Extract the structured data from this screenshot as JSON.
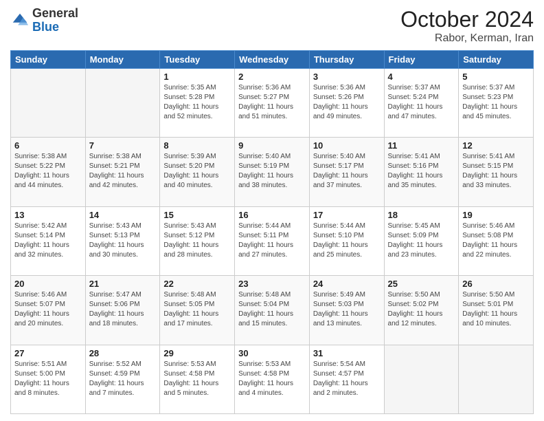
{
  "header": {
    "logo": {
      "line1": "General",
      "line2": "Blue"
    },
    "month": "October 2024",
    "location": "Rabor, Kerman, Iran"
  },
  "weekdays": [
    "Sunday",
    "Monday",
    "Tuesday",
    "Wednesday",
    "Thursday",
    "Friday",
    "Saturday"
  ],
  "weeks": [
    [
      {
        "day": "",
        "sunrise": "",
        "sunset": "",
        "daylight": ""
      },
      {
        "day": "",
        "sunrise": "",
        "sunset": "",
        "daylight": ""
      },
      {
        "day": "1",
        "sunrise": "Sunrise: 5:35 AM",
        "sunset": "Sunset: 5:28 PM",
        "daylight": "Daylight: 11 hours and 52 minutes."
      },
      {
        "day": "2",
        "sunrise": "Sunrise: 5:36 AM",
        "sunset": "Sunset: 5:27 PM",
        "daylight": "Daylight: 11 hours and 51 minutes."
      },
      {
        "day": "3",
        "sunrise": "Sunrise: 5:36 AM",
        "sunset": "Sunset: 5:26 PM",
        "daylight": "Daylight: 11 hours and 49 minutes."
      },
      {
        "day": "4",
        "sunrise": "Sunrise: 5:37 AM",
        "sunset": "Sunset: 5:24 PM",
        "daylight": "Daylight: 11 hours and 47 minutes."
      },
      {
        "day": "5",
        "sunrise": "Sunrise: 5:37 AM",
        "sunset": "Sunset: 5:23 PM",
        "daylight": "Daylight: 11 hours and 45 minutes."
      }
    ],
    [
      {
        "day": "6",
        "sunrise": "Sunrise: 5:38 AM",
        "sunset": "Sunset: 5:22 PM",
        "daylight": "Daylight: 11 hours and 44 minutes."
      },
      {
        "day": "7",
        "sunrise": "Sunrise: 5:38 AM",
        "sunset": "Sunset: 5:21 PM",
        "daylight": "Daylight: 11 hours and 42 minutes."
      },
      {
        "day": "8",
        "sunrise": "Sunrise: 5:39 AM",
        "sunset": "Sunset: 5:20 PM",
        "daylight": "Daylight: 11 hours and 40 minutes."
      },
      {
        "day": "9",
        "sunrise": "Sunrise: 5:40 AM",
        "sunset": "Sunset: 5:19 PM",
        "daylight": "Daylight: 11 hours and 38 minutes."
      },
      {
        "day": "10",
        "sunrise": "Sunrise: 5:40 AM",
        "sunset": "Sunset: 5:17 PM",
        "daylight": "Daylight: 11 hours and 37 minutes."
      },
      {
        "day": "11",
        "sunrise": "Sunrise: 5:41 AM",
        "sunset": "Sunset: 5:16 PM",
        "daylight": "Daylight: 11 hours and 35 minutes."
      },
      {
        "day": "12",
        "sunrise": "Sunrise: 5:41 AM",
        "sunset": "Sunset: 5:15 PM",
        "daylight": "Daylight: 11 hours and 33 minutes."
      }
    ],
    [
      {
        "day": "13",
        "sunrise": "Sunrise: 5:42 AM",
        "sunset": "Sunset: 5:14 PM",
        "daylight": "Daylight: 11 hours and 32 minutes."
      },
      {
        "day": "14",
        "sunrise": "Sunrise: 5:43 AM",
        "sunset": "Sunset: 5:13 PM",
        "daylight": "Daylight: 11 hours and 30 minutes."
      },
      {
        "day": "15",
        "sunrise": "Sunrise: 5:43 AM",
        "sunset": "Sunset: 5:12 PM",
        "daylight": "Daylight: 11 hours and 28 minutes."
      },
      {
        "day": "16",
        "sunrise": "Sunrise: 5:44 AM",
        "sunset": "Sunset: 5:11 PM",
        "daylight": "Daylight: 11 hours and 27 minutes."
      },
      {
        "day": "17",
        "sunrise": "Sunrise: 5:44 AM",
        "sunset": "Sunset: 5:10 PM",
        "daylight": "Daylight: 11 hours and 25 minutes."
      },
      {
        "day": "18",
        "sunrise": "Sunrise: 5:45 AM",
        "sunset": "Sunset: 5:09 PM",
        "daylight": "Daylight: 11 hours and 23 minutes."
      },
      {
        "day": "19",
        "sunrise": "Sunrise: 5:46 AM",
        "sunset": "Sunset: 5:08 PM",
        "daylight": "Daylight: 11 hours and 22 minutes."
      }
    ],
    [
      {
        "day": "20",
        "sunrise": "Sunrise: 5:46 AM",
        "sunset": "Sunset: 5:07 PM",
        "daylight": "Daylight: 11 hours and 20 minutes."
      },
      {
        "day": "21",
        "sunrise": "Sunrise: 5:47 AM",
        "sunset": "Sunset: 5:06 PM",
        "daylight": "Daylight: 11 hours and 18 minutes."
      },
      {
        "day": "22",
        "sunrise": "Sunrise: 5:48 AM",
        "sunset": "Sunset: 5:05 PM",
        "daylight": "Daylight: 11 hours and 17 minutes."
      },
      {
        "day": "23",
        "sunrise": "Sunrise: 5:48 AM",
        "sunset": "Sunset: 5:04 PM",
        "daylight": "Daylight: 11 hours and 15 minutes."
      },
      {
        "day": "24",
        "sunrise": "Sunrise: 5:49 AM",
        "sunset": "Sunset: 5:03 PM",
        "daylight": "Daylight: 11 hours and 13 minutes."
      },
      {
        "day": "25",
        "sunrise": "Sunrise: 5:50 AM",
        "sunset": "Sunset: 5:02 PM",
        "daylight": "Daylight: 11 hours and 12 minutes."
      },
      {
        "day": "26",
        "sunrise": "Sunrise: 5:50 AM",
        "sunset": "Sunset: 5:01 PM",
        "daylight": "Daylight: 11 hours and 10 minutes."
      }
    ],
    [
      {
        "day": "27",
        "sunrise": "Sunrise: 5:51 AM",
        "sunset": "Sunset: 5:00 PM",
        "daylight": "Daylight: 11 hours and 8 minutes."
      },
      {
        "day": "28",
        "sunrise": "Sunrise: 5:52 AM",
        "sunset": "Sunset: 4:59 PM",
        "daylight": "Daylight: 11 hours and 7 minutes."
      },
      {
        "day": "29",
        "sunrise": "Sunrise: 5:53 AM",
        "sunset": "Sunset: 4:58 PM",
        "daylight": "Daylight: 11 hours and 5 minutes."
      },
      {
        "day": "30",
        "sunrise": "Sunrise: 5:53 AM",
        "sunset": "Sunset: 4:58 PM",
        "daylight": "Daylight: 11 hours and 4 minutes."
      },
      {
        "day": "31",
        "sunrise": "Sunrise: 5:54 AM",
        "sunset": "Sunset: 4:57 PM",
        "daylight": "Daylight: 11 hours and 2 minutes."
      },
      {
        "day": "",
        "sunrise": "",
        "sunset": "",
        "daylight": ""
      },
      {
        "day": "",
        "sunrise": "",
        "sunset": "",
        "daylight": ""
      }
    ]
  ]
}
